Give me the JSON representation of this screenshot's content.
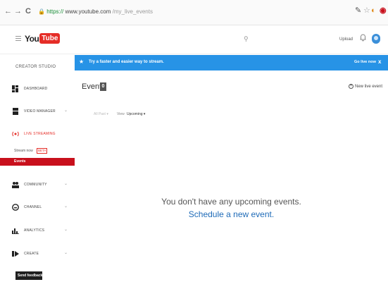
{
  "browser": {
    "back": "←",
    "forward": "→",
    "reload": "C",
    "url_scheme": "https://",
    "url_host": "www.youtube.com",
    "url_path": "/my_live_events"
  },
  "header": {
    "logo_you": "You",
    "logo_tube": "Tube",
    "upload_label": "Upload"
  },
  "sidebar": {
    "section_title": "CREATOR STUDIO",
    "items": {
      "dashboard": "DASHBOARD",
      "video_manager": "VIDEO MANAGER",
      "live_streaming": "LIVE STREAMING",
      "community": "COMMUNITY",
      "channel": "CHANNEL",
      "analytics": "ANALYTICS",
      "create": "CREATE"
    },
    "sub_items": {
      "stream_now": "Stream now",
      "beta": "BETA",
      "events": "Events"
    },
    "feedback": "Send feedback"
  },
  "banner": {
    "message": "Try a faster and easier way to stream.",
    "action": "Go live now",
    "close": "x"
  },
  "main": {
    "title": "Events",
    "count": "0",
    "new_event": "New live event",
    "filter_past": "All Past ▾",
    "filter_view": "View",
    "filter_selected": "Upcoming ▾",
    "empty_message": "You don't have any upcoming events.",
    "schedule_link": "Schedule a new event."
  },
  "colors": {
    "banner": "#2793e6",
    "active_item": "#c8101c",
    "link": "#1f6bb8",
    "brand_red": "#e52d27"
  }
}
